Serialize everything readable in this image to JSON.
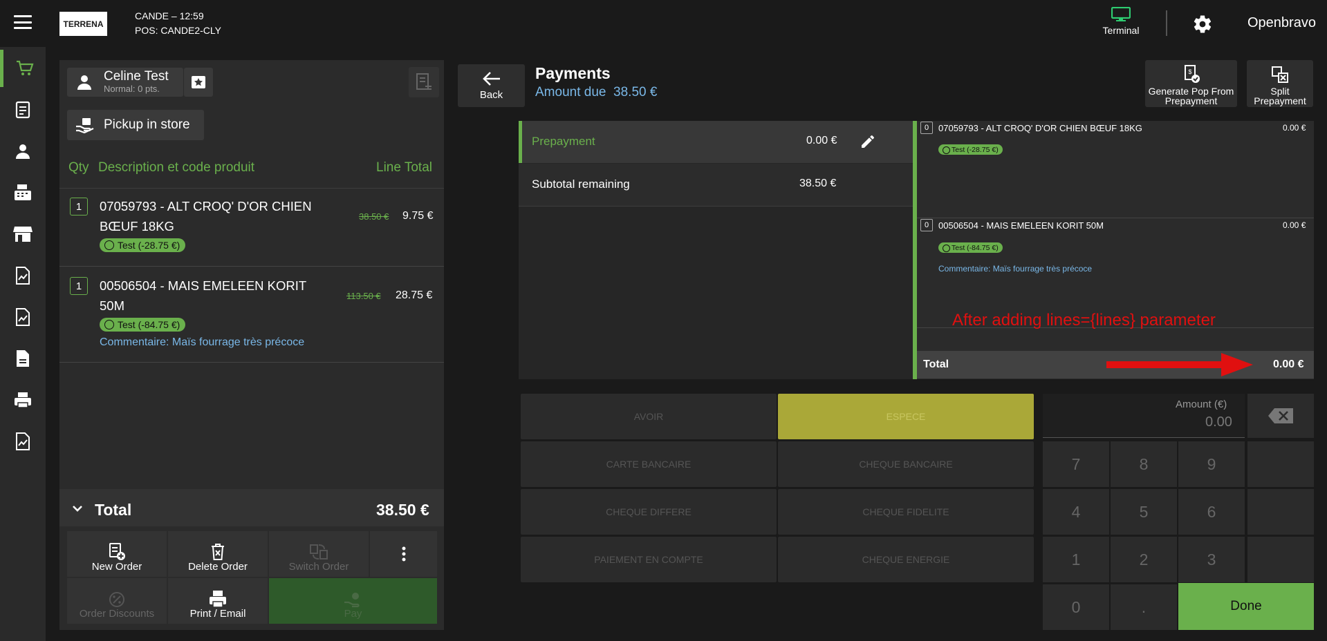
{
  "header": {
    "logo_text": "TERRENA",
    "store_line1": "CANDE – 12:59",
    "store_line2": "POS: CANDE2-CLY",
    "terminal_label": "Terminal",
    "user_label": "Openbravo"
  },
  "nav": {
    "icons": [
      "cart-icon",
      "receipts-icon",
      "customer-icon",
      "cash-register-icon",
      "store-icon",
      "report-icon",
      "report2-icon",
      "document-icon",
      "printer-icon",
      "report3-icon"
    ]
  },
  "ticket": {
    "customer_name": "Celine Test",
    "customer_points": "Normal: 0 pts.",
    "pickup_label": "Pickup in store",
    "col_qty": "Qty",
    "col_desc": "Description et code produit",
    "col_total": "Line Total",
    "lines": [
      {
        "qty": "1",
        "desc": "07059793 - ALT CROQ' D'OR CHIEN BŒUF 18KG",
        "old_price": "38.50 €",
        "total": "9.75 €",
        "promo": "Test (-28.75 €)",
        "comment": ""
      },
      {
        "qty": "1",
        "desc": "00506504 - MAIS EMELEEN KORIT 50M",
        "old_price": "113.50 €",
        "total": "28.75 €",
        "promo": "Test (-84.75 €)",
        "comment": "Commentaire: Maïs fourrage très précoce"
      }
    ],
    "total_label": "Total",
    "total_value": "38.50 €",
    "buttons": {
      "new_order": "New Order",
      "delete_order": "Delete Order",
      "switch_order": "Switch Order",
      "order_discounts": "Order Discounts",
      "print_email": "Print / Email",
      "pay": "Pay"
    }
  },
  "payments": {
    "back_label": "Back",
    "title": "Payments",
    "amount_due_label": "Amount due",
    "amount_due_value": "38.50 €",
    "generate_pop": "Generate Pop From Prepayment",
    "split_prepayment": "Split Prepayment",
    "prepayment_label": "Prepayment",
    "prepayment_value": "0.00 €",
    "subtotal_label": "Subtotal remaining",
    "subtotal_value": "38.50 €"
  },
  "mini_receipt": {
    "lines": [
      {
        "qty": "0",
        "desc": "07059793 - ALT CROQ' D'OR CHIEN BŒUF 18KG",
        "value": "0.00 €",
        "promo": "Test (-28.75 €)",
        "comment": ""
      },
      {
        "qty": "0",
        "desc": "00506504 - MAIS EMELEEN KORIT 50M",
        "value": "0.00 €",
        "promo": "Test (-84.75 €)",
        "comment": "Commentaire: Maïs fourrage très précoce"
      }
    ],
    "annotation": "After adding lines={lines} parameter",
    "total_label": "Total",
    "total_value": "0.00 €",
    "annotation_color": "#e01010"
  },
  "methods": [
    "AVOIR",
    "ESPECE",
    "CARTE BANCAIRE",
    "CHEQUE BANCAIRE",
    "CHEQUE DIFFERE",
    "CHEQUE FIDELITE",
    "PAIEMENT EN COMPTE",
    "CHEQUE ENERGIE"
  ],
  "selected_method": "ESPECE",
  "keypad": {
    "amount_label": "Amount (€)",
    "amount_value": "0.00",
    "keys": [
      "7",
      "8",
      "9",
      "4",
      "5",
      "6",
      "1",
      "2",
      "3",
      "0",
      "."
    ],
    "done_label": "Done"
  },
  "colors": {
    "accent": "#6ab04c",
    "selected_method": "#aaa838",
    "link": "#7ab8e8"
  }
}
